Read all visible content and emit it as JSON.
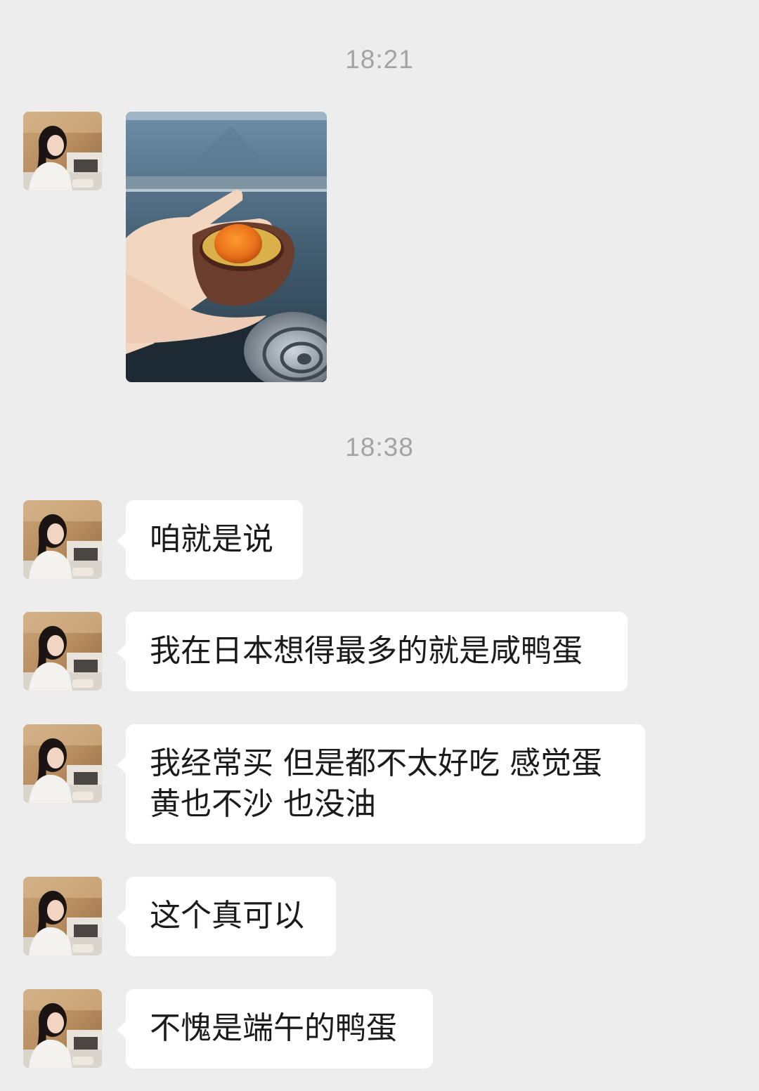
{
  "chat": {
    "timestamps": [
      "18:21",
      "18:38"
    ],
    "avatar_icon": "user-avatar-photo",
    "photo_icon": "salted-duck-egg-photo",
    "messages": [
      {
        "text": "咱就是说"
      },
      {
        "text": "我在日本想得最多的就是咸鸭蛋"
      },
      {
        "text": "我经常买 但是都不太好吃 感觉蛋黄也不沙 也没油"
      },
      {
        "text": "这个真可以"
      },
      {
        "text": "不愧是端午的鸭蛋"
      }
    ]
  },
  "colors": {
    "background": "#ededed",
    "bubble": "#ffffff",
    "timestamp": "#a3a3a3",
    "text": "#1b1b1b"
  }
}
